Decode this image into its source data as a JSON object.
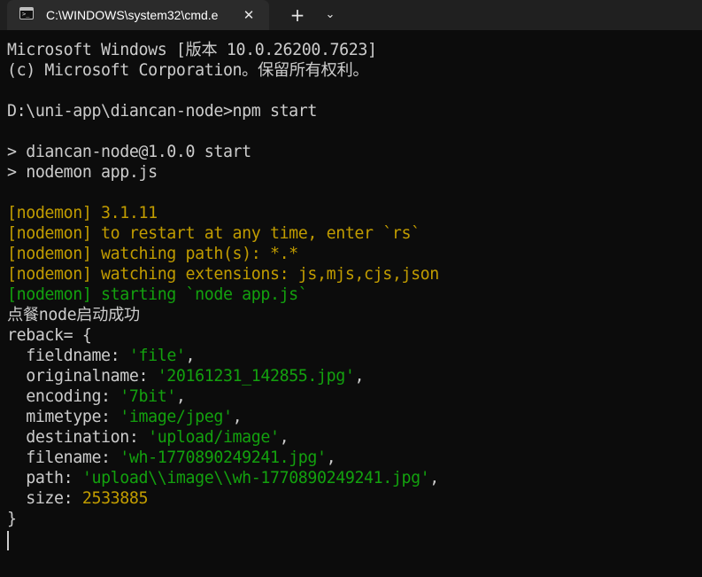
{
  "window": {
    "tab_title": "C:\\WINDOWS\\system32\\cmd.e",
    "close_glyph": "✕",
    "new_tab_glyph": "+",
    "dropdown_glyph": "⌄",
    "icon": "cmd-icon"
  },
  "colors": {
    "background": "#0c0c0c",
    "text": "#cccccc",
    "nodemon_yellow": "#c19c00",
    "nodemon_green": "#13a10e"
  },
  "terminal": {
    "lines": [
      {
        "type": "plain",
        "text": "Microsoft Windows [版本 10.0.26200.7623]"
      },
      {
        "type": "plain",
        "text": "(c) Microsoft Corporation。保留所有权利。"
      },
      {
        "type": "blank",
        "text": ""
      },
      {
        "type": "plain",
        "text": "D:\\uni-app\\diancan-node>npm start"
      },
      {
        "type": "blank",
        "text": ""
      },
      {
        "type": "plain",
        "text": "> diancan-node@1.0.0 start"
      },
      {
        "type": "plain",
        "text": "> nodemon app.js"
      },
      {
        "type": "blank",
        "text": ""
      },
      {
        "type": "yellow",
        "text": "[nodemon] 3.1.11"
      },
      {
        "type": "yellow",
        "text": "[nodemon] to restart at any time, enter `rs`"
      },
      {
        "type": "yellow",
        "text": "[nodemon] watching path(s): *.*"
      },
      {
        "type": "yellow",
        "text": "[nodemon] watching extensions: js,mjs,cjs,json"
      },
      {
        "type": "green",
        "text": "[nodemon] starting `node app.js`"
      },
      {
        "type": "plain",
        "text": "点餐node启动成功"
      },
      {
        "type": "plain",
        "text": "reback= {"
      },
      {
        "type": "kv",
        "key": "  fieldname: ",
        "value": "'file'",
        "valueColor": "green",
        "suffix": ","
      },
      {
        "type": "kv",
        "key": "  originalname: ",
        "value": "'20161231_142855.jpg'",
        "valueColor": "green",
        "suffix": ","
      },
      {
        "type": "kv",
        "key": "  encoding: ",
        "value": "'7bit'",
        "valueColor": "green",
        "suffix": ","
      },
      {
        "type": "kv",
        "key": "  mimetype: ",
        "value": "'image/jpeg'",
        "valueColor": "green",
        "suffix": ","
      },
      {
        "type": "kv",
        "key": "  destination: ",
        "value": "'upload/image'",
        "valueColor": "green",
        "suffix": ","
      },
      {
        "type": "kv",
        "key": "  filename: ",
        "value": "'wh-1770890249241.jpg'",
        "valueColor": "green",
        "suffix": ","
      },
      {
        "type": "kv",
        "key": "  path: ",
        "value": "'upload\\\\image\\\\wh-1770890249241.jpg'",
        "valueColor": "green",
        "suffix": ","
      },
      {
        "type": "kv",
        "key": "  size: ",
        "value": "2533885",
        "valueColor": "yellow",
        "suffix": ""
      },
      {
        "type": "plain",
        "text": "}"
      }
    ]
  }
}
